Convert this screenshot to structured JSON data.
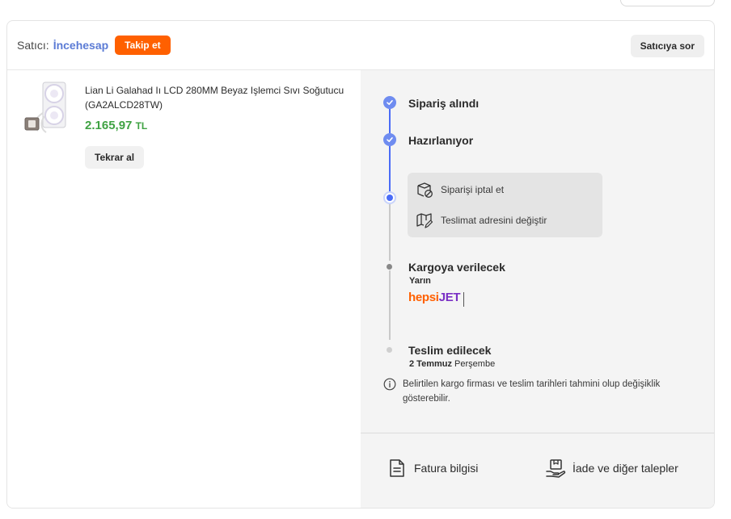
{
  "seller": {
    "label": "Satıcı:",
    "name": "İncehesap",
    "follow_label": "Takip et",
    "ask_label": "Satıcıya sor"
  },
  "product": {
    "name": "Lian Li Galahad Iı LCD 280MM Beyaz Işlemci Sıvı Soğutucu (GA2ALCD28TW)",
    "price": "2.165,97",
    "currency": "TL",
    "reorder_label": "Tekrar al"
  },
  "timeline": {
    "steps": [
      {
        "title": "Sipariş alındı",
        "status": "done"
      },
      {
        "title": "Hazırlanıyor",
        "status": "done"
      },
      {
        "title": "Kargoya verilecek",
        "status": "pending",
        "subtitle": "Yarın"
      },
      {
        "title": "Teslim edilecek",
        "status": "pending",
        "date_bold": "2 Temmuz",
        "date_rest": "Perşembe"
      }
    ],
    "actions": [
      {
        "label": "Siparişi iptal et",
        "icon": "cancel-box-icon"
      },
      {
        "label": "Teslimat adresini değiştir",
        "icon": "map-edit-icon"
      }
    ],
    "carrier": {
      "part1": "hepsi",
      "part2": "JET"
    },
    "info_text": "Belirtilen kargo firması ve teslim tarihleri tahmini olup değişiklik gösterebilir."
  },
  "footer": {
    "invoice_label": "Fatura bilgisi",
    "returns_label": "İade ve diğer talepler"
  },
  "colors": {
    "accent_orange": "#ff6000",
    "seller_blue": "#5b7bd5",
    "price_green": "#3fa243",
    "timeline_blue": "#4a6cf7",
    "carrier_purple": "#7a2fc4"
  }
}
